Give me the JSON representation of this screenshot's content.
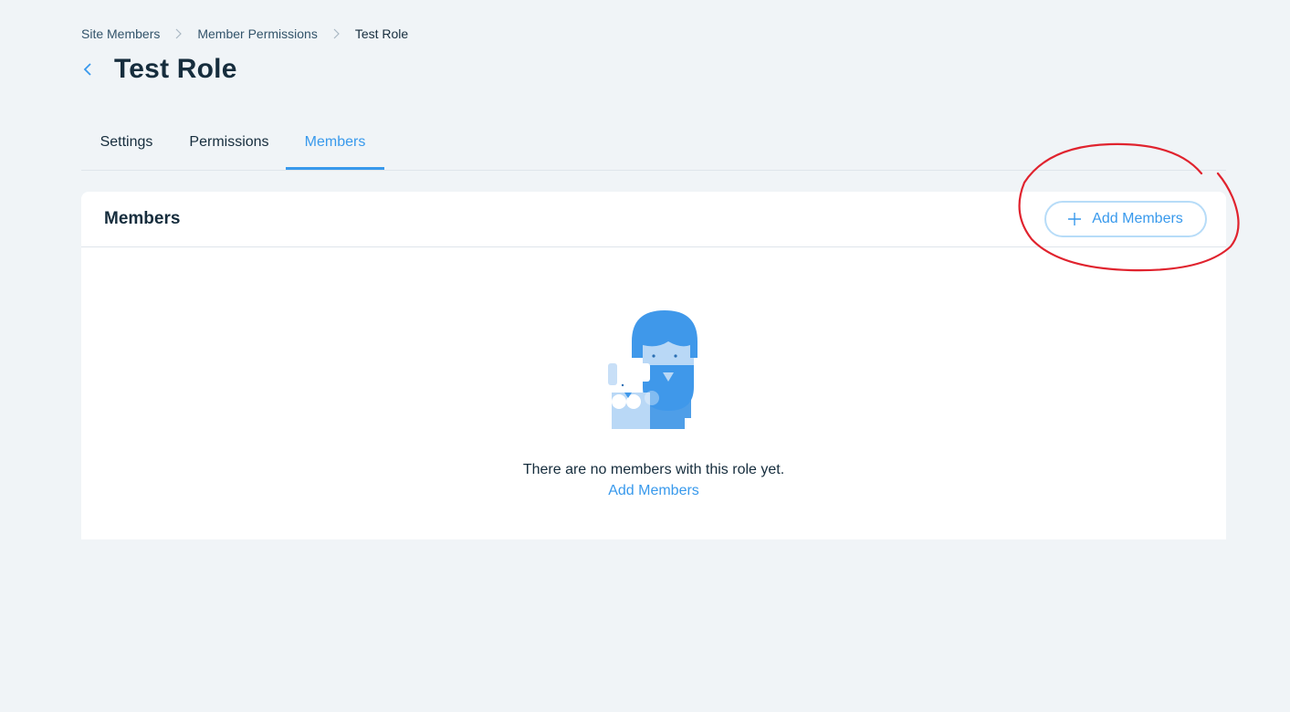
{
  "breadcrumb": {
    "items": [
      "Site Members",
      "Member Permissions",
      "Test Role"
    ]
  },
  "page": {
    "title": "Test Role"
  },
  "tabs": [
    {
      "label": "Settings",
      "active": false
    },
    {
      "label": "Permissions",
      "active": false
    },
    {
      "label": "Members",
      "active": true
    }
  ],
  "members_card": {
    "title": "Members",
    "add_button_label": "Add Members",
    "empty_message": "There are no members with this role yet.",
    "empty_link_label": "Add Members"
  },
  "colors": {
    "accent": "#3899ec",
    "background": "#f0f4f7",
    "text": "#162d3d",
    "annotation": "#e0232e"
  },
  "icons": [
    "chevron-left-icon",
    "chevron-right-icon",
    "plus-icon",
    "empty-state-illustration"
  ]
}
